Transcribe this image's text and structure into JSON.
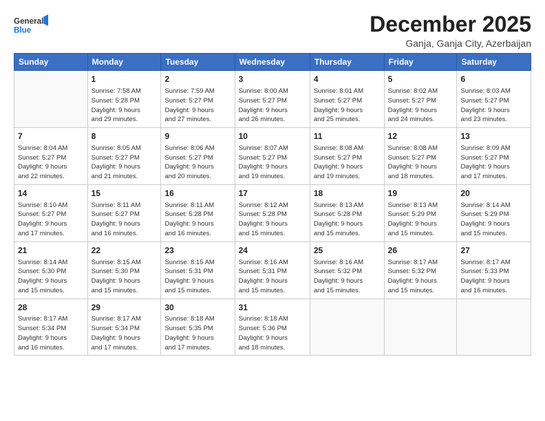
{
  "logo": {
    "line1": "General",
    "line2": "Blue"
  },
  "title": "December 2025",
  "subtitle": "Ganja, Ganja City, Azerbaijan",
  "header": {
    "accent_color": "#3a6fc4"
  },
  "weekdays": [
    "Sunday",
    "Monday",
    "Tuesday",
    "Wednesday",
    "Thursday",
    "Friday",
    "Saturday"
  ],
  "weeks": [
    [
      {
        "day": "",
        "info": ""
      },
      {
        "day": "1",
        "info": "Sunrise: 7:58 AM\nSunset: 5:28 PM\nDaylight: 9 hours\nand 29 minutes."
      },
      {
        "day": "2",
        "info": "Sunrise: 7:59 AM\nSunset: 5:27 PM\nDaylight: 9 hours\nand 27 minutes."
      },
      {
        "day": "3",
        "info": "Sunrise: 8:00 AM\nSunset: 5:27 PM\nDaylight: 9 hours\nand 26 minutes."
      },
      {
        "day": "4",
        "info": "Sunrise: 8:01 AM\nSunset: 5:27 PM\nDaylight: 9 hours\nand 25 minutes."
      },
      {
        "day": "5",
        "info": "Sunrise: 8:02 AM\nSunset: 5:27 PM\nDaylight: 9 hours\nand 24 minutes."
      },
      {
        "day": "6",
        "info": "Sunrise: 8:03 AM\nSunset: 5:27 PM\nDaylight: 9 hours\nand 23 minutes."
      }
    ],
    [
      {
        "day": "7",
        "info": "Sunrise: 8:04 AM\nSunset: 5:27 PM\nDaylight: 9 hours\nand 22 minutes."
      },
      {
        "day": "8",
        "info": "Sunrise: 8:05 AM\nSunset: 5:27 PM\nDaylight: 9 hours\nand 21 minutes."
      },
      {
        "day": "9",
        "info": "Sunrise: 8:06 AM\nSunset: 5:27 PM\nDaylight: 9 hours\nand 20 minutes."
      },
      {
        "day": "10",
        "info": "Sunrise: 8:07 AM\nSunset: 5:27 PM\nDaylight: 9 hours\nand 19 minutes."
      },
      {
        "day": "11",
        "info": "Sunrise: 8:08 AM\nSunset: 5:27 PM\nDaylight: 9 hours\nand 19 minutes."
      },
      {
        "day": "12",
        "info": "Sunrise: 8:08 AM\nSunset: 5:27 PM\nDaylight: 9 hours\nand 18 minutes."
      },
      {
        "day": "13",
        "info": "Sunrise: 8:09 AM\nSunset: 5:27 PM\nDaylight: 9 hours\nand 17 minutes."
      }
    ],
    [
      {
        "day": "14",
        "info": "Sunrise: 8:10 AM\nSunset: 5:27 PM\nDaylight: 9 hours\nand 17 minutes."
      },
      {
        "day": "15",
        "info": "Sunrise: 8:11 AM\nSunset: 5:27 PM\nDaylight: 9 hours\nand 16 minutes."
      },
      {
        "day": "16",
        "info": "Sunrise: 8:11 AM\nSunset: 5:28 PM\nDaylight: 9 hours\nand 16 minutes."
      },
      {
        "day": "17",
        "info": "Sunrise: 8:12 AM\nSunset: 5:28 PM\nDaylight: 9 hours\nand 15 minutes."
      },
      {
        "day": "18",
        "info": "Sunrise: 8:13 AM\nSunset: 5:28 PM\nDaylight: 9 hours\nand 15 minutes."
      },
      {
        "day": "19",
        "info": "Sunrise: 8:13 AM\nSunset: 5:29 PM\nDaylight: 9 hours\nand 15 minutes."
      },
      {
        "day": "20",
        "info": "Sunrise: 8:14 AM\nSunset: 5:29 PM\nDaylight: 9 hours\nand 15 minutes."
      }
    ],
    [
      {
        "day": "21",
        "info": "Sunrise: 8:14 AM\nSunset: 5:30 PM\nDaylight: 9 hours\nand 15 minutes."
      },
      {
        "day": "22",
        "info": "Sunrise: 8:15 AM\nSunset: 5:30 PM\nDaylight: 9 hours\nand 15 minutes."
      },
      {
        "day": "23",
        "info": "Sunrise: 8:15 AM\nSunset: 5:31 PM\nDaylight: 9 hours\nand 15 minutes."
      },
      {
        "day": "24",
        "info": "Sunrise: 8:16 AM\nSunset: 5:31 PM\nDaylight: 9 hours\nand 15 minutes."
      },
      {
        "day": "25",
        "info": "Sunrise: 8:16 AM\nSunset: 5:32 PM\nDaylight: 9 hours\nand 15 minutes."
      },
      {
        "day": "26",
        "info": "Sunrise: 8:17 AM\nSunset: 5:32 PM\nDaylight: 9 hours\nand 15 minutes."
      },
      {
        "day": "27",
        "info": "Sunrise: 8:17 AM\nSunset: 5:33 PM\nDaylight: 9 hours\nand 16 minutes."
      }
    ],
    [
      {
        "day": "28",
        "info": "Sunrise: 8:17 AM\nSunset: 5:34 PM\nDaylight: 9 hours\nand 16 minutes."
      },
      {
        "day": "29",
        "info": "Sunrise: 8:17 AM\nSunset: 5:34 PM\nDaylight: 9 hours\nand 17 minutes."
      },
      {
        "day": "30",
        "info": "Sunrise: 8:18 AM\nSunset: 5:35 PM\nDaylight: 9 hours\nand 17 minutes."
      },
      {
        "day": "31",
        "info": "Sunrise: 8:18 AM\nSunset: 5:36 PM\nDaylight: 9 hours\nand 18 minutes."
      },
      {
        "day": "",
        "info": ""
      },
      {
        "day": "",
        "info": ""
      },
      {
        "day": "",
        "info": ""
      }
    ]
  ]
}
